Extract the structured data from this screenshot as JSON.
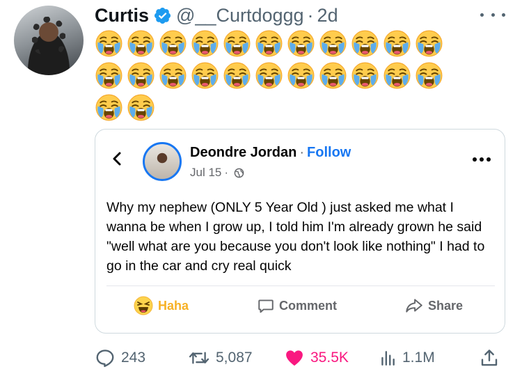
{
  "tweet": {
    "author_name": "Curtis",
    "handle": "@__Curtdoggg",
    "separator": "·",
    "time": "2d",
    "emoji_rows": [
      11,
      11,
      2
    ],
    "emoji_name": "loudly-crying-face"
  },
  "quoted_post": {
    "author_name": "Deondre Jordan",
    "separator": "·",
    "follow_label": "Follow",
    "date": "Jul 15",
    "date_separator": "·",
    "text": "Why my nephew (ONLY 5 Year Old ) just asked me what I wanna be when I grow up, I told him I'm already grown he said \"well what are you because you don't look like nothing\" I had to go in the car and cry real quick",
    "actions": {
      "haha_label": "Haha",
      "comment_label": "Comment",
      "share_label": "Share"
    }
  },
  "metrics": {
    "replies": "243",
    "retweets": "5,087",
    "likes": "35.5K",
    "views": "1.1M"
  },
  "colors": {
    "verified": "#1d9bf0",
    "facebook_blue": "#1877f2",
    "like_pink": "#f91880",
    "haha_yellow": "#f7b125"
  }
}
